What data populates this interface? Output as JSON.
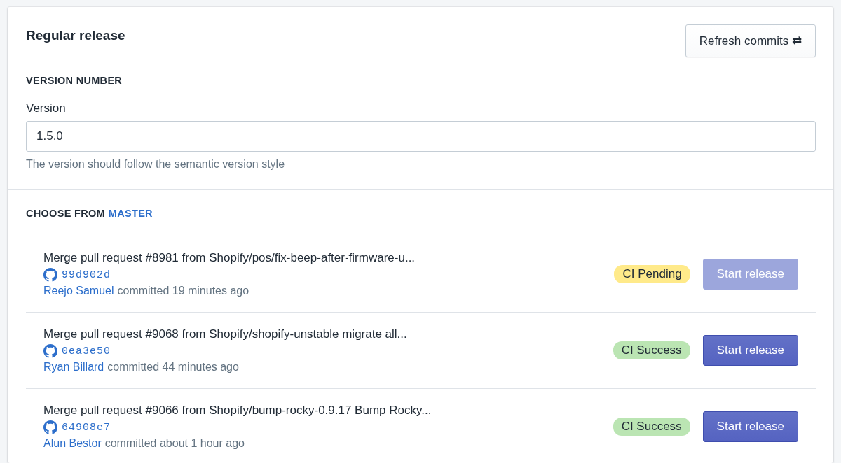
{
  "title": "Regular release",
  "refresh_button": {
    "label": "Refresh commits ⇄"
  },
  "version_section": {
    "heading": "VERSION NUMBER",
    "field_label": "Version",
    "value": "1.5.0",
    "hint": "The version should follow the semantic version style"
  },
  "commits_section": {
    "heading": "CHOOSE FROM",
    "branch": "MASTER"
  },
  "commits": [
    {
      "message": "Merge pull request #8981 from Shopify/pos/fix-beep-after-firmware-u...",
      "hash": "99d902d",
      "author": "Reejo Samuel",
      "time": "committed 19 minutes ago",
      "status": {
        "kind": "pending",
        "label": "CI Pending"
      },
      "button": {
        "label": "Start release",
        "disabled": true
      }
    },
    {
      "message": "Merge pull request #9068 from Shopify/shopify-unstable migrate all...",
      "hash": "0ea3e50",
      "author": "Ryan Billard",
      "time": "committed 44 minutes ago",
      "status": {
        "kind": "success",
        "label": "CI Success"
      },
      "button": {
        "label": "Start release",
        "disabled": false
      }
    },
    {
      "message": "Merge pull request #9066 from Shopify/bump-rocky-0.9.17 Bump Rocky...",
      "hash": "64908e7",
      "author": "Alun Bestor",
      "time": "committed about 1 hour ago",
      "status": {
        "kind": "success",
        "label": "CI Success"
      },
      "button": {
        "label": "Start release",
        "disabled": false
      }
    }
  ]
}
